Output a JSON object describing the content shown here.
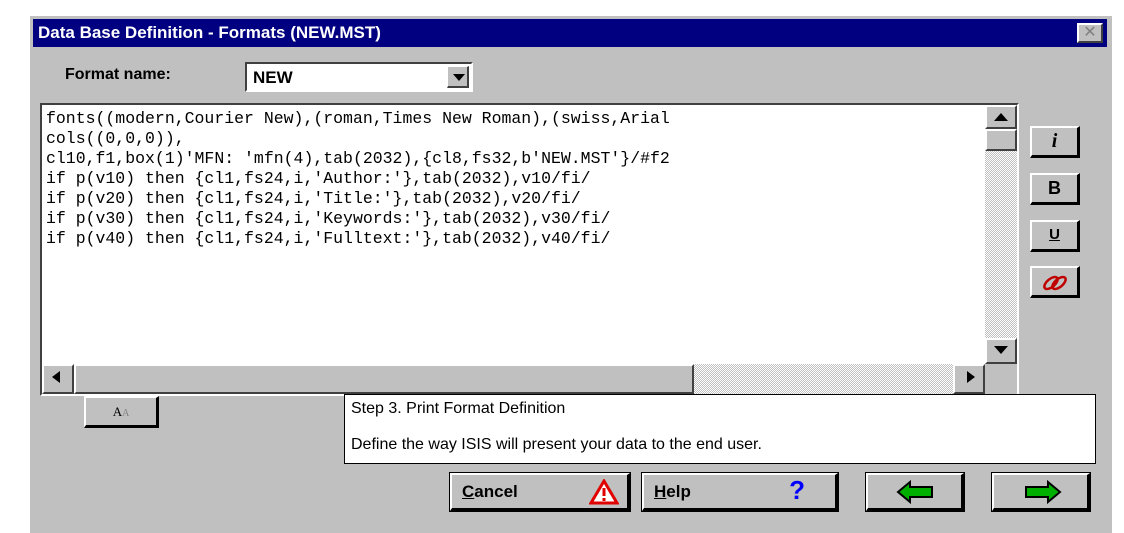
{
  "window": {
    "title": "Data Base Definition - Formats (NEW.MST)",
    "close_glyph": "✕"
  },
  "format": {
    "label": "Format name:",
    "value": "NEW"
  },
  "editor": {
    "lines": [
      "fonts((modern,Courier New),(roman,Times New Roman),(swiss,Arial",
      "cols((0,0,0)),",
      "cl10,f1,box(1)'MFN: 'mfn(4),tab(2032),{cl8,fs32,b'NEW.MST'}/#f2",
      "if p(v10) then {cl1,fs24,i,'Author:'},tab(2032),v10/fi/",
      "if p(v20) then {cl1,fs24,i,'Title:'},tab(2032),v20/fi/",
      "if p(v30) then {cl1,fs24,i,'Keywords:'},tab(2032),v30/fi/",
      "if p(v40) then {cl1,fs24,i,'Fulltext:'},tab(2032),v40/fi/"
    ]
  },
  "style_buttons": {
    "italic": "i",
    "bold": "B",
    "underline": "U"
  },
  "font_button_label": "A",
  "step": {
    "title": "Step 3. Print Format Definition",
    "description": "Define the way ISIS will present your data to the end user."
  },
  "buttons": {
    "cancel_mnemonic": "C",
    "cancel_rest": "ancel",
    "help_mnemonic": "H",
    "help_rest": "elp",
    "help_glyph": "?"
  },
  "colors": {
    "titlebar": "#000080",
    "face": "#c0c0c0",
    "warning_red": "#e00000",
    "help_blue": "#0000ff",
    "arrow_green": "#00b000",
    "link_red": "#c00000"
  }
}
